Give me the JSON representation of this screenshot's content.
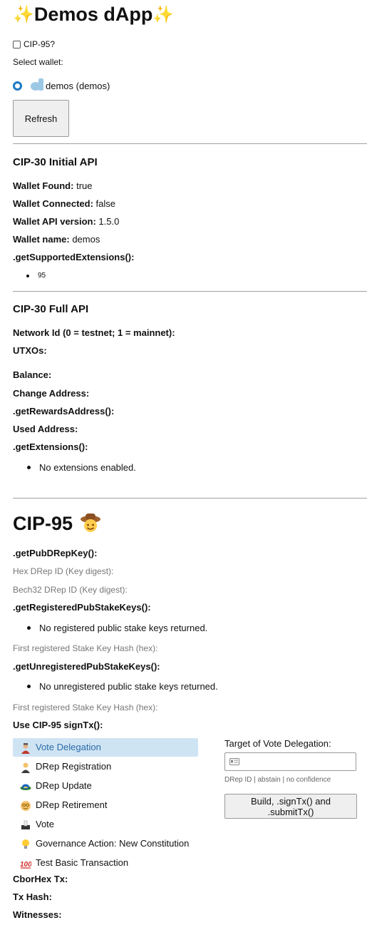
{
  "header": {
    "title": "Demos dApp"
  },
  "cip95_checkbox": {
    "label": "CIP-95?"
  },
  "select_wallet_label": "Select wallet:",
  "wallet_option": {
    "label": "demos (demos)"
  },
  "refresh_button": "Refresh",
  "initial_api": {
    "heading": "CIP-30 Initial API",
    "rows": [
      {
        "key": "Wallet Found:",
        "value": "true"
      },
      {
        "key": "Wallet Connected:",
        "value": "false"
      },
      {
        "key": "Wallet API version:",
        "value": "1.5.0"
      },
      {
        "key": "Wallet name:",
        "value": "demos"
      }
    ],
    "supported_ext_label": ".getSupportedExtensions():",
    "supported_ext_items": [
      "95"
    ]
  },
  "full_api": {
    "heading": "CIP-30 Full API",
    "labels": {
      "network": "Network Id (0 = testnet; 1 = mainnet):",
      "utxos": "UTXOs:",
      "balance": "Balance:",
      "change_address": "Change Address:",
      "rewards": ".getRewardsAddress():",
      "used_address": "Used Address:",
      "extensions": ".getExtensions():"
    },
    "extensions_items": [
      "No extensions enabled."
    ]
  },
  "cip95": {
    "heading": "CIP-95",
    "getpub_label": ".getPubDRepKey():",
    "hex_drep": "Hex DRep ID (Key digest):",
    "bech_drep": "Bech32 DRep ID (Key digest):",
    "registered_label": ".getRegisteredPubStakeKeys():",
    "registered_items": [
      "No registered public stake keys returned."
    ],
    "first_reg_hash_1": "First registered Stake Key Hash (hex):",
    "unregistered_label": ".getUnregisteredPubStakeKeys():",
    "unregistered_items": [
      "No unregistered public stake keys returned."
    ],
    "first_reg_hash_2": "First registered Stake Key Hash (hex):",
    "signtx_label": "Use CIP-95 signTx():",
    "menu": [
      {
        "label": "Vote Delegation"
      },
      {
        "label": "DRep Registration"
      },
      {
        "label": "DRep Update"
      },
      {
        "label": "DRep Retirement"
      },
      {
        "label": "Vote"
      },
      {
        "label": "Governance Action: New Constitution"
      },
      {
        "label": "Test Basic Transaction"
      }
    ],
    "target_label": "Target of Vote Delegation:",
    "target_hint": "DRep ID | abstain | no confidence",
    "build_button": "Build, .signTx() and .submitTx()",
    "cborhex": "CborHex Tx:",
    "txhash": "Tx Hash:",
    "witnesses": "Witnesses:"
  },
  "colors": {
    "accent": "#1e7ac4",
    "active_bg": "#cfe4f3",
    "active_text": "#2a6aa8"
  }
}
